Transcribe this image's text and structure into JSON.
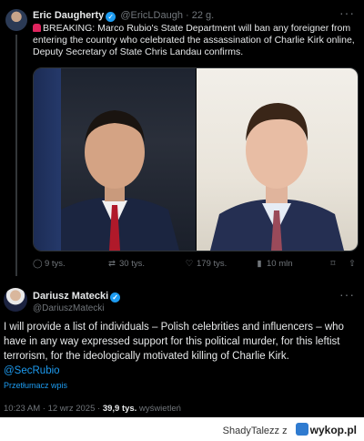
{
  "post1": {
    "author_name": "Eric Daugherty",
    "handle": "@EricLDaugh",
    "time": "22 g.",
    "separator": "·",
    "more_label": "···",
    "text": "BREAKING: Marco Rubio's State Department will ban any foreigner from entering the country who celebrated the assassination of Charlie Kirk online, Deputy Secretary of State Chris Landau confirms.",
    "actions": {
      "replies": "9 tys.",
      "reposts": "30 tys.",
      "likes": "179 tys.",
      "views": "10 mln"
    }
  },
  "post2": {
    "author_name": "Dariusz Matecki",
    "handle": "@DariuszMatecki",
    "more_label": "···",
    "text": "I will provide a list of individuals – Polish celebrities and influencers – who have in any way expressed support for this political murder, for this leftist terrorism, for the ideologically motivated killing of Charlie Kirk.",
    "mention": "@SecRubio",
    "translate_label": "Przetłumacz wpis",
    "time": "10:23 AM",
    "date": "12 wrz 2025",
    "views_count": "39,9 tys.",
    "views_label": "wyświetleń",
    "separator": "·"
  },
  "footer": {
    "credit_user": "ShadyTalezz",
    "credit_joiner": "z",
    "site": "wykop.pl"
  },
  "icons": {
    "verified": "verified-badge-icon",
    "reply": "reply-icon",
    "repost": "repost-icon",
    "like": "heart-icon",
    "views": "views-chart-icon",
    "bookmark": "bookmark-icon",
    "share": "share-icon"
  },
  "colors": {
    "accent": "#1d9bf0",
    "background": "#000000",
    "muted": "#71767b"
  }
}
